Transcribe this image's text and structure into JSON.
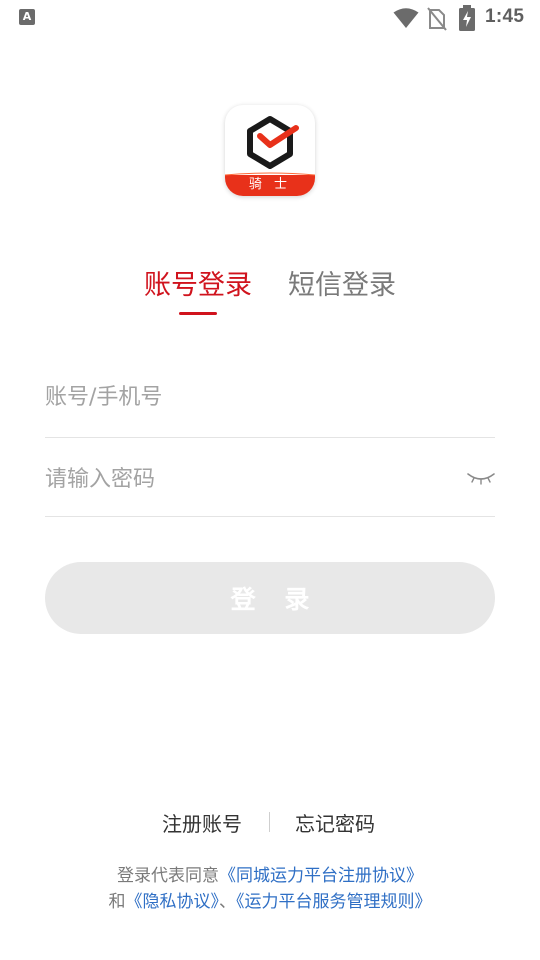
{
  "status_bar": {
    "app_indicator": "A",
    "time": "1:45",
    "icons": [
      "wifi-icon",
      "no-sim-icon",
      "battery-charging-icon"
    ]
  },
  "logo": {
    "badge_text": "骑 士",
    "brand_colors": {
      "red": "#e8311a",
      "dark": "#1a1a1a"
    }
  },
  "tabs": [
    {
      "label": "账号登录",
      "active": true
    },
    {
      "label": "短信登录",
      "active": false
    }
  ],
  "form": {
    "account_placeholder": "账号/手机号",
    "account_value": "",
    "password_placeholder": "请输入密码",
    "password_value": "",
    "password_toggle_icon": "eye-closed-icon"
  },
  "login_button": {
    "label": "登 录"
  },
  "links": {
    "register": "注册账号",
    "forgot": "忘记密码"
  },
  "agreement": {
    "prefix": "登录代表同意",
    "platform_agreement": "《同城运力平台注册协议》",
    "and": "和",
    "privacy": "《隐私协议》",
    "separator": "、",
    "service_rules": "《运力平台服务管理规则》"
  },
  "colors": {
    "accent": "#d0131d",
    "inactive_tab": "#7a7a7a",
    "link": "#2f6fc5",
    "button_disabled": "#e8e8e8"
  }
}
